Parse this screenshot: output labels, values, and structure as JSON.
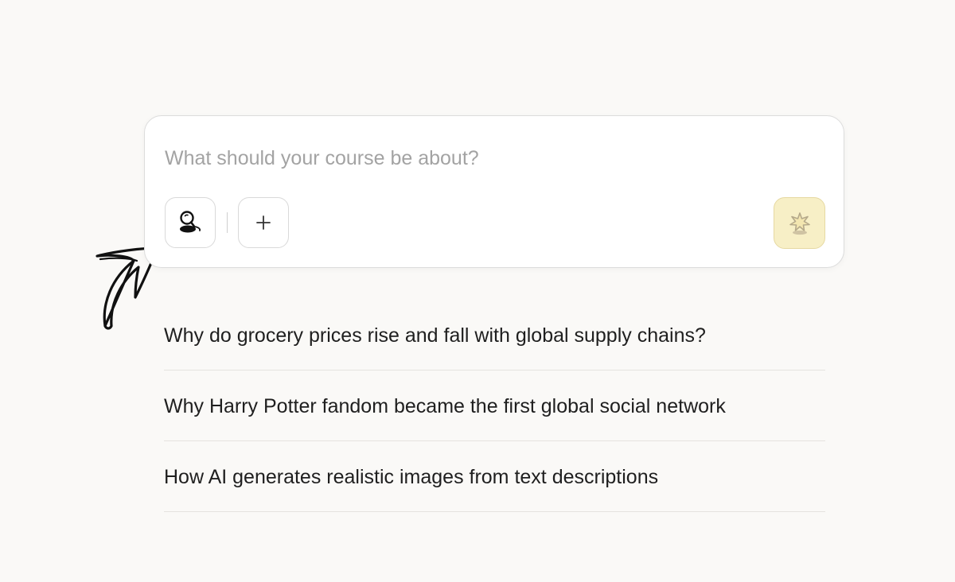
{
  "prompt": {
    "placeholder": "What should your course be about?",
    "value": ""
  },
  "toolbar": {
    "research_icon": "research-magnifier-icon",
    "add_icon": "plus-icon",
    "add_label": "+",
    "generate_icon": "sparkle-icon"
  },
  "colors": {
    "background": "#faf9f7",
    "generate_button": "#f7efc6",
    "generate_border": "#e6d9a2",
    "placeholder": "#a3a3a3",
    "text": "#1f1f1f"
  },
  "suggestions": [
    {
      "label": "Why do grocery prices rise and fall with global supply chains?"
    },
    {
      "label": "Why Harry Potter fandom became the first global social network"
    },
    {
      "label": "How AI generates realistic images from text descriptions"
    }
  ]
}
